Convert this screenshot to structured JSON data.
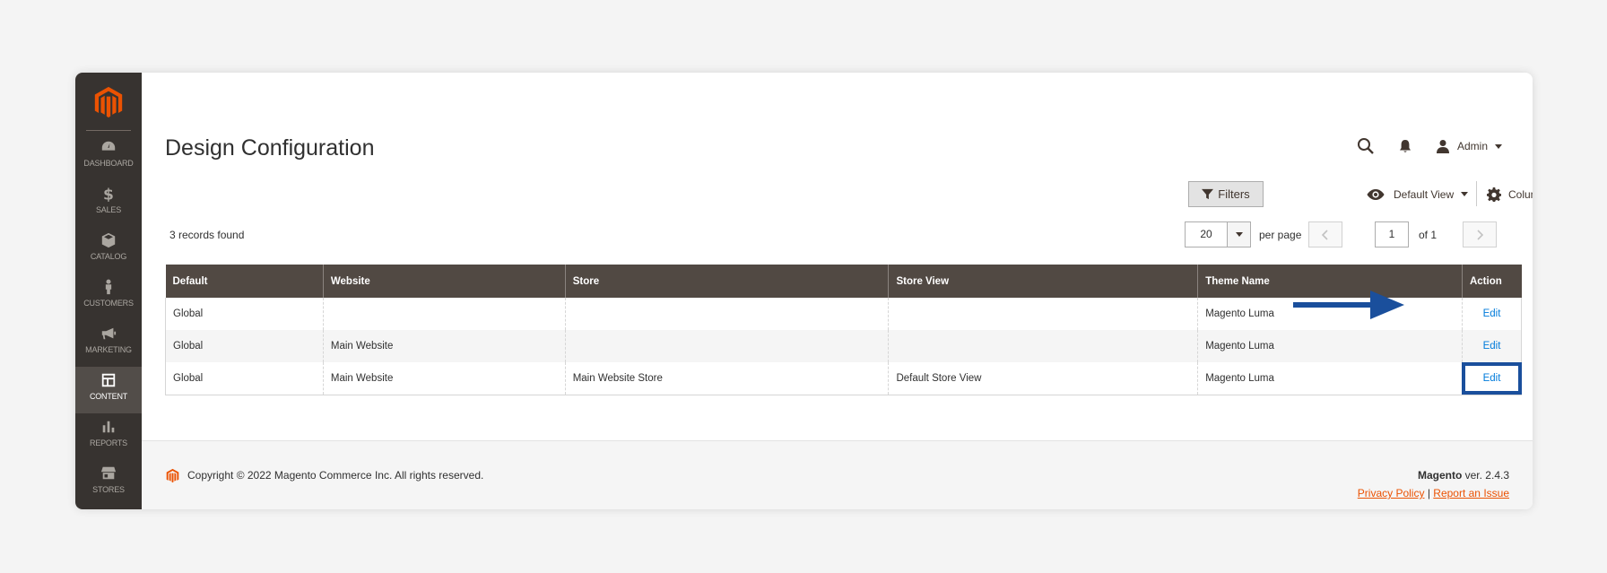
{
  "sidebar": {
    "items": [
      {
        "label": "DASHBOARD",
        "icon": "dashboard-icon"
      },
      {
        "label": "SALES",
        "icon": "dollar-icon"
      },
      {
        "label": "CATALOG",
        "icon": "box-icon"
      },
      {
        "label": "CUSTOMERS",
        "icon": "person-icon"
      },
      {
        "label": "MARKETING",
        "icon": "megaphone-icon"
      },
      {
        "label": "CONTENT",
        "icon": "layout-icon"
      },
      {
        "label": "REPORTS",
        "icon": "bar-chart-icon"
      },
      {
        "label": "STORES",
        "icon": "storefront-icon"
      }
    ],
    "active": "CONTENT"
  },
  "header": {
    "title": "Design Configuration",
    "user": "Admin"
  },
  "toolbar": {
    "filters_label": "Filters",
    "view_label": "Default View",
    "columns_label": "Columns"
  },
  "pagination": {
    "records_found": "3 records found",
    "per_page_value": "20",
    "per_page_label": "per page",
    "current_page": "1",
    "of_pages": "of 1",
    "prev_icon": "chevron-left-icon",
    "next_icon": "chevron-right-icon"
  },
  "grid": {
    "columns": [
      "Default",
      "Website",
      "Store",
      "Store View",
      "Theme Name",
      "Action"
    ],
    "rows": [
      {
        "default": "Global",
        "website": "",
        "store": "",
        "store_view": "",
        "theme": "Magento Luma",
        "action": "Edit"
      },
      {
        "default": "Global",
        "website": "Main Website",
        "store": "",
        "store_view": "",
        "theme": "Magento Luma",
        "action": "Edit"
      },
      {
        "default": "Global",
        "website": "Main Website",
        "store": "Main Website Store",
        "store_view": "Default Store View",
        "theme": "Magento Luma",
        "action": "Edit"
      }
    ]
  },
  "footer": {
    "copyright": "Copyright © 2022 Magento Commerce Inc. All rights reserved.",
    "brand": "Magento",
    "version": " ver. 2.4.3",
    "privacy_link": "Privacy Policy",
    "separator": "|",
    "report_link": "Report an Issue"
  },
  "colors": {
    "sidebar_bg": "#373330",
    "brand_orange": "#eb5202",
    "grid_header": "#514943",
    "link_blue": "#007bdb",
    "highlight_blue": "#1a4f9c"
  }
}
